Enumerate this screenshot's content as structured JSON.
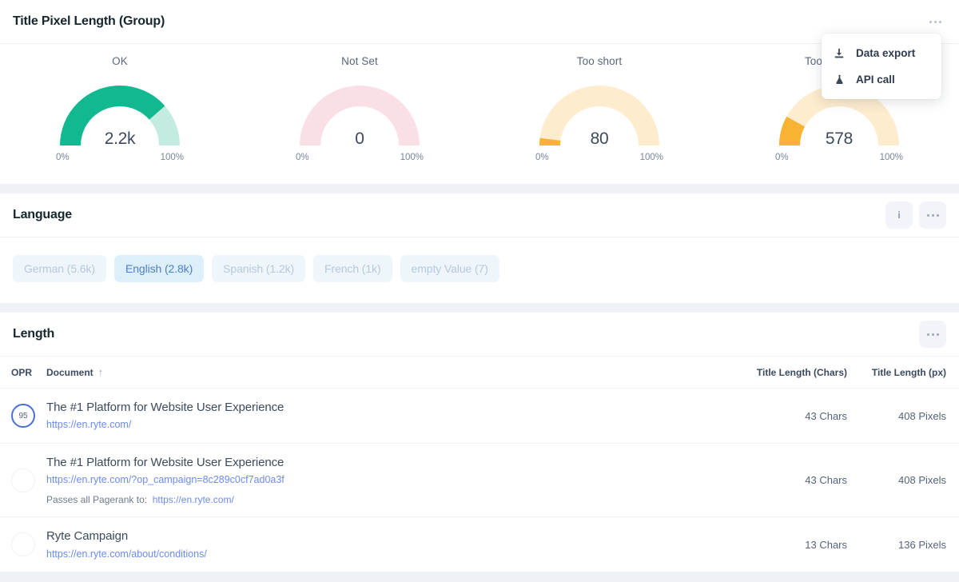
{
  "colors": {
    "page_bg": "#eef1f5",
    "card_bg": "#ffffff",
    "green": "#11b890",
    "green_light": "#c3ebe0",
    "pink_light": "#fadfe6",
    "orange": "#f9b233",
    "orange_light": "#fdeccd",
    "accent_blue": "#4f7fc4",
    "link_blue": "#6b8bf0"
  },
  "gauges_card": {
    "title": "Title Pixel Length (Group)",
    "more_icon": "ellipsis-icon",
    "menu": {
      "items": [
        {
          "label": "Data export",
          "icon": "download-icon"
        },
        {
          "label": "API call",
          "icon": "flask-icon"
        }
      ]
    },
    "gauges": [
      {
        "label": "OK",
        "value": "2.2k",
        "percent": 77,
        "min_tick": "0%",
        "max_tick": "100%",
        "color": "#11b890",
        "track": "#c3ebe0"
      },
      {
        "label": "Not Set",
        "value": "0",
        "percent": 0,
        "min_tick": "0%",
        "max_tick": "100%",
        "color": "#f5b9c8",
        "track": "#fadfe6"
      },
      {
        "label": "Too short",
        "value": "80",
        "percent": 4,
        "min_tick": "0%",
        "max_tick": "100%",
        "color": "#f9b233",
        "track": "#fdeccd"
      },
      {
        "label": "Too long on m",
        "value": "578",
        "percent": 16,
        "min_tick": "0%",
        "max_tick": "100%",
        "color": "#f9b233",
        "track": "#fdeccd"
      }
    ]
  },
  "language_card": {
    "title": "Language",
    "info_icon": "info-icon",
    "more_icon": "ellipsis-icon",
    "chips": [
      {
        "label": "German (5.6k)",
        "active": false
      },
      {
        "label": "English (2.8k)",
        "active": true
      },
      {
        "label": "Spanish (1.2k)",
        "active": false
      },
      {
        "label": "French (1k)",
        "active": false
      },
      {
        "label": "empty Value (7)",
        "active": false
      }
    ]
  },
  "length_card": {
    "title": "Length",
    "more_icon": "ellipsis-icon",
    "columns": {
      "opr": "OPR",
      "document": "Document",
      "sort_icon": "↑",
      "chars": "Title Length (Chars)",
      "px": "Title Length (px)"
    },
    "rows": [
      {
        "opr": "95",
        "opr_filled": true,
        "title": "The #1 Platform for Website User Experience",
        "url": "https://en.ryte.com/",
        "sub_label": "",
        "sub_url": "",
        "chars": "43 Chars",
        "px": "408 Pixels"
      },
      {
        "opr": "",
        "opr_filled": false,
        "title": "The #1 Platform for Website User Experience",
        "url": "https://en.ryte.com/?op_campaign=8c289c0cf7ad0a3f",
        "sub_label": "Passes all Pagerank to:",
        "sub_url": "https://en.ryte.com/",
        "chars": "43 Chars",
        "px": "408 Pixels"
      },
      {
        "opr": "",
        "opr_filled": false,
        "title": "Ryte Campaign",
        "url": "https://en.ryte.com/about/conditions/",
        "sub_label": "",
        "sub_url": "",
        "chars": "13 Chars",
        "px": "136 Pixels"
      }
    ]
  }
}
